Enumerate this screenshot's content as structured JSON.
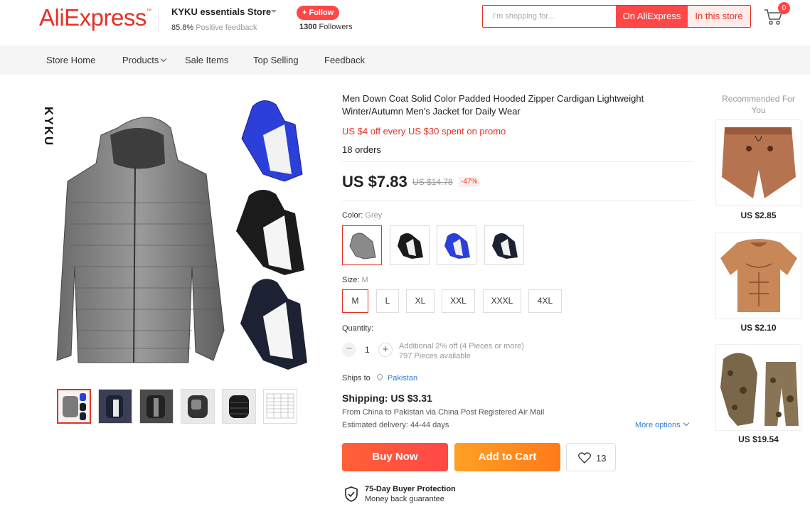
{
  "header": {
    "logo": "AliExpress",
    "store_name": "KYKU essentials Store",
    "feedback_pct": "85.8%",
    "feedback_label": "Positive feedback",
    "follow_label": "+ Follow",
    "followers_count": "1300",
    "followers_label": "Followers",
    "search_placeholder": "I'm shopping for...",
    "search_on_ali": "On AliExpress",
    "search_in_store": "In this store",
    "cart_count": "0"
  },
  "nav": {
    "items": [
      "Store Home",
      "Products",
      "Sale Items",
      "Top Selling",
      "Feedback"
    ]
  },
  "gallery": {
    "brand": "KYKU",
    "thumbnail_count": 6,
    "active_thumbnail": 0
  },
  "product": {
    "title": "Men Down Coat Solid Color Padded Hooded Zipper Cardigan Lightweight Winter/Autumn Men's Jacket for Daily Wear",
    "promo": "US $4 off every US $30 spent on promo",
    "orders": "18 orders",
    "price": "US $7.83",
    "old_price": "US $14.78",
    "discount": "-47%",
    "color_label": "Color:",
    "color_value": "Grey",
    "colors": [
      "grey",
      "black",
      "blue",
      "navy"
    ],
    "size_label": "Size:",
    "size_value": "M",
    "sizes": [
      "M",
      "L",
      "XL",
      "XXL",
      "XXXL",
      "4XL"
    ],
    "quantity_label": "Quantity:",
    "quantity_minus": "−",
    "quantity": "1",
    "quantity_plus": "+",
    "qty_note_1": "Additional 2% off (4 Pieces or more)",
    "qty_note_2": "797 Pieces available",
    "ships_to_label": "Ships to",
    "ships_to": "Pakistan",
    "shipping_title": "Shipping: US $3.31",
    "shipping_from": "From China to Pakistan via China Post Registered Air Mail",
    "estimated_delivery": "Estimated delivery: 44-44 days",
    "more_options": "More options",
    "buy_now": "Buy Now",
    "add_to_cart": "Add to Cart",
    "wishlist_count": "13",
    "protection_title": "75-Day Buyer Protection",
    "protection_sub": "Money back guarantee"
  },
  "recommended": {
    "title": "Recommended For You",
    "items": [
      {
        "price": "US $2.85"
      },
      {
        "price": "US $2.10"
      },
      {
        "price": "US $19.54"
      }
    ]
  },
  "colors": {
    "accent": "#e43225",
    "button_red": "#ff4747",
    "button_orange": "#ff8c1a",
    "link_blue": "#2e7ed3"
  }
}
